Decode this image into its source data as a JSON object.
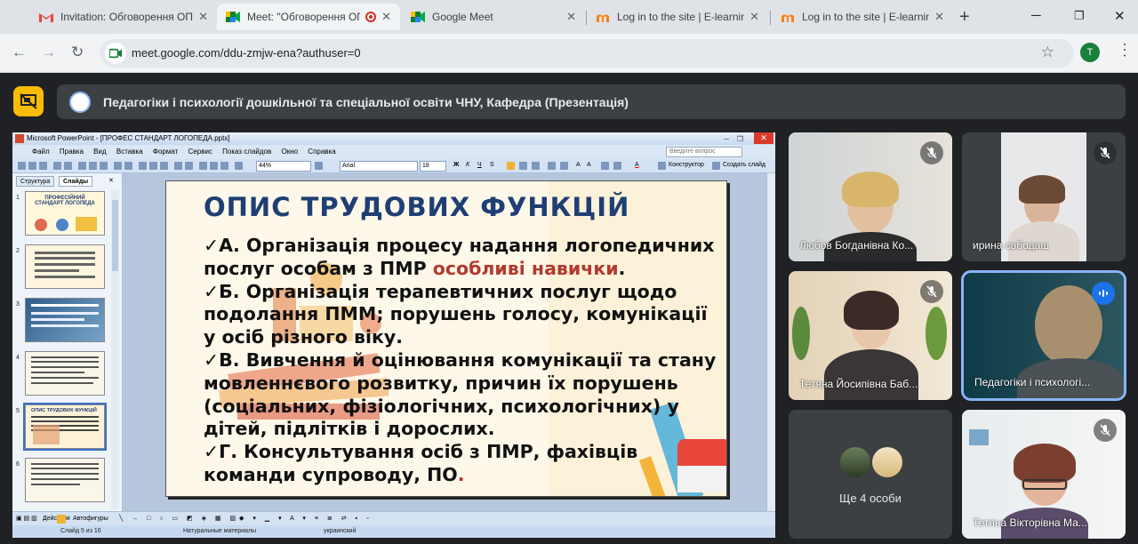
{
  "browser": {
    "tabs": [
      {
        "label": "Invitation: Обговорення ОП",
        "icon": "gmail-icon",
        "active": false
      },
      {
        "label": "Meet: \"Обговорення ОП",
        "icon": "meet-icon",
        "active": true
      },
      {
        "label": "Google Meet",
        "icon": "meet-icon",
        "active": false
      },
      {
        "label": "Log in to the site | E-learning",
        "icon": "moodle-icon",
        "active": false
      },
      {
        "label": "Log in to the site | E-learning",
        "icon": "moodle-icon",
        "active": false
      }
    ],
    "url": "meet.google.com/ddu-zmjw-ena?authuser=0",
    "profile_initial": "T"
  },
  "meet": {
    "presentation_title": "Педагогіки і психології дошкільної та спеціальної освіти ЧНУ, Кафедра (Презентація)"
  },
  "ppt": {
    "window_title": "Microsoft PowerPoint - [ПРОФЕС СТАНДАРТ ЛОГОПЕДА.pptx]",
    "menu": [
      "Файл",
      "Правка",
      "Вид",
      "Вставка",
      "Формат",
      "Сервис",
      "Показ слайдов",
      "Окно",
      "Справка"
    ],
    "ask_placeholder": "Введите вопрос",
    "zoom": "44%",
    "font": "Arial",
    "font_size": "18",
    "constructor_label": "Конструктор",
    "create_slide_label": "Создать слайд",
    "panel_tabs": [
      "Структура",
      "Слайды"
    ],
    "thumb_numbers": [
      "1",
      "2",
      "3",
      "4",
      "5",
      "6"
    ],
    "thumb1_title": "ПРОФЕСІЙНИЙ СТАНДАРТ ЛОГОПЕДА",
    "thumb5_title": "ОПИС ТРУДОВИХ ФУНКЦІЙ",
    "slide": {
      "title": "ОПИС  ТРУДОВИХ  ФУНКЦІЙ",
      "item_a": "✓А. Організація процесу надання логопедичних послуг особам з ПМР ",
      "item_a_red": "особливі навички",
      "item_a_end": ".",
      "item_b": "✓Б. Організація терапевтичних послуг щодо подолання ПММ; порушень голосу, комунікації у осіб різного віку.",
      "item_c": "✓В. Вивчення й оцінювання комунікації та стану мовленнєвого розвитку, причин їх порушень (соціальних, фізіологічних, психологічних) у дітей, підлітків і дорослих.",
      "item_d": "✓Г. Консультування осіб з ПМР, фахівців команди супроводу, ПО",
      "item_d_red": "."
    },
    "draw_toolbar": {
      "actions": "Действия",
      "autoshapes": "Автофигуры"
    },
    "status": {
      "slide": "Слайд 5 из 16",
      "design": "Натуральные материалы",
      "lang": "украинский"
    }
  },
  "participants": [
    {
      "name": "Любов Богданівна Ко...",
      "muted": true
    },
    {
      "name": "ирина сабодаш",
      "muted": true
    },
    {
      "name": "Тетяна Йосипівна Баб...",
      "muted": true
    },
    {
      "name": "Педагогіки і психологі...",
      "muted": false,
      "speaking": true
    },
    {
      "name": "Ще 4 особи"
    },
    {
      "name": "Тетяна Вікторівна Ма...",
      "muted": true
    }
  ],
  "colors": {
    "accent": "#fbbc04",
    "speaking": "#1a73e8",
    "slide_title": "#1f3f74",
    "slide_red": "#b23a2e"
  }
}
